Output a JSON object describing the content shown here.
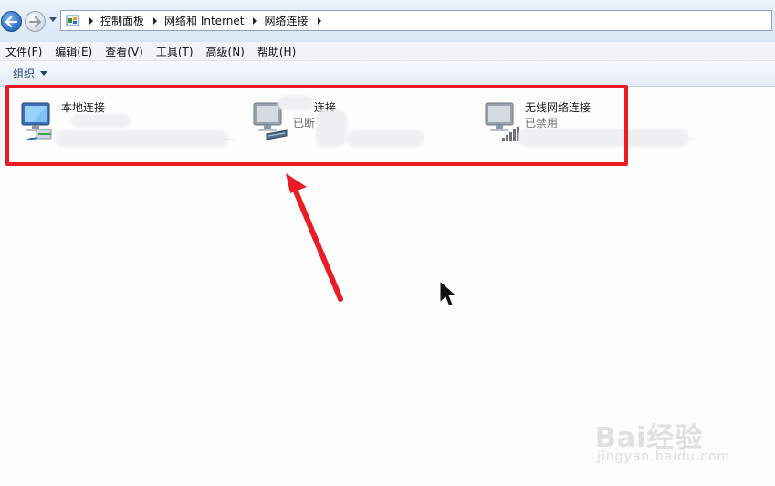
{
  "breadcrumb": {
    "items": [
      "控制面板",
      "网络和 Internet",
      "网络连接"
    ]
  },
  "menu": {
    "items": [
      "文件(F)",
      "编辑(E)",
      "查看(V)",
      "工具(T)",
      "高级(N)",
      "帮助(H)"
    ]
  },
  "toolbar": {
    "organize_label": "组织"
  },
  "connections": [
    {
      "name": "本地连接",
      "status": "",
      "ellipsis": "...",
      "icon": "wired-network-icon"
    },
    {
      "name": "连接",
      "status": "已断",
      "ellipsis": "",
      "icon": "broadband-network-icon"
    },
    {
      "name": "无线网络连接",
      "status": "已禁用",
      "ellipsis": "...",
      "icon": "wireless-network-icon"
    }
  ],
  "watermark": {
    "brand": "Bai经验",
    "url": "jingyan.baidu.com"
  },
  "colors": {
    "annotation": "#ea1c24",
    "nav_back": "#2c6fc6"
  }
}
